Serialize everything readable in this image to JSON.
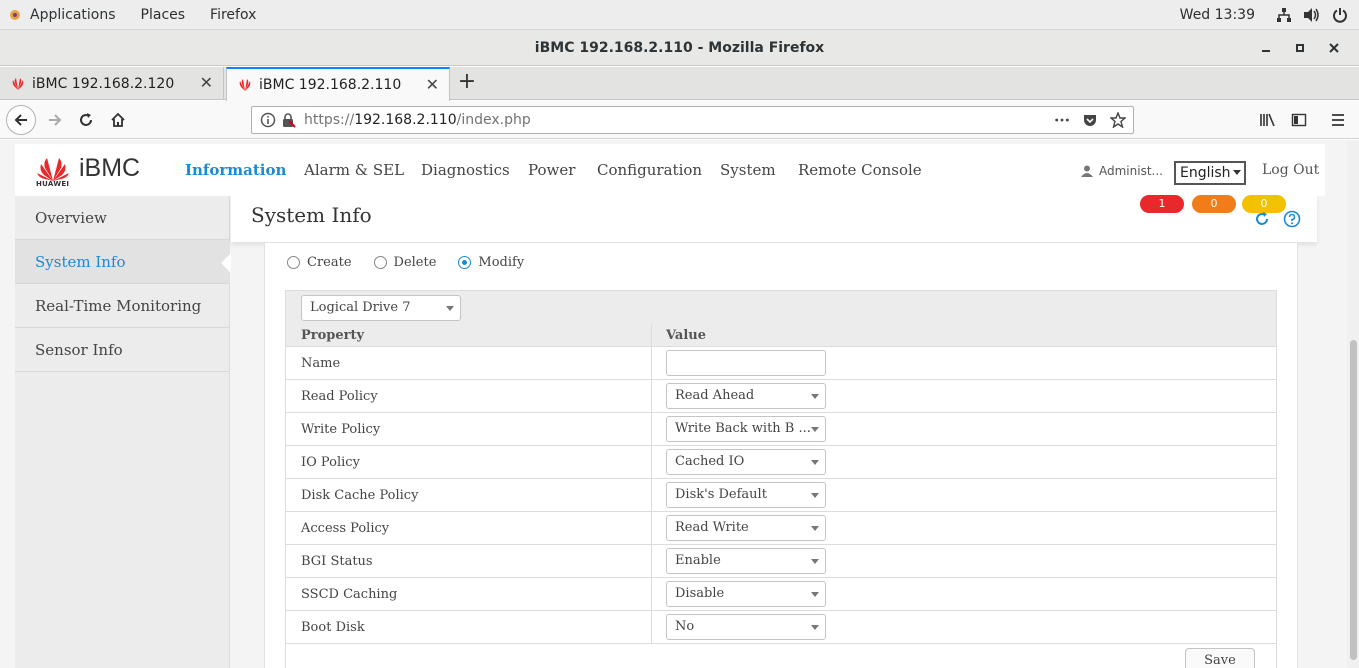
{
  "gnome": {
    "applications": "Applications",
    "places": "Places",
    "firefox": "Firefox",
    "clock": "Wed 13:39"
  },
  "window": {
    "title": "iBMC 192.168.2.110 - Mozilla Firefox"
  },
  "tabs": [
    {
      "label": "iBMC 192.168.2.120"
    },
    {
      "label": "iBMC 192.168.2.110"
    }
  ],
  "url": {
    "prefix": "https://",
    "host": "192.168.2.110",
    "path": "/index.php"
  },
  "ibmc": {
    "logo": "iBMC",
    "brand": "HUAWEI",
    "menu": [
      "Information",
      "Alarm & SEL",
      "Diagnostics",
      "Power",
      "Configuration",
      "System",
      "Remote Console"
    ],
    "user": "Administ...",
    "language": "English",
    "logout": "Log Out",
    "alarms": {
      "critical": "1",
      "major": "0",
      "minor": "0"
    },
    "colors": {
      "accent": "#1a8bd4",
      "critical": "#e8282b",
      "major": "#f07d1a",
      "minor": "#f2c200"
    }
  },
  "sidebar": {
    "items": [
      {
        "label": "Overview"
      },
      {
        "label": "System Info"
      },
      {
        "label": "Real-Time Monitoring"
      },
      {
        "label": "Sensor Info"
      }
    ]
  },
  "content": {
    "title": "System Info",
    "radios": [
      "Create",
      "Delete",
      "Modify"
    ],
    "selected_radio": "Modify",
    "logical_drive": "Logical Drive 7",
    "table": {
      "headers": [
        "Property",
        "Value"
      ],
      "rows": [
        {
          "property": "Name",
          "value": ""
        },
        {
          "property": "Read Policy",
          "value": "Read Ahead"
        },
        {
          "property": "Write Policy",
          "value": "Write Back with B ..."
        },
        {
          "property": "IO Policy",
          "value": "Cached IO"
        },
        {
          "property": "Disk Cache Policy",
          "value": "Disk's Default"
        },
        {
          "property": "Access Policy",
          "value": "Read Write"
        },
        {
          "property": "BGI Status",
          "value": "Enable"
        },
        {
          "property": "SSCD Caching",
          "value": "Disable"
        },
        {
          "property": "Boot Disk",
          "value": "No"
        }
      ]
    },
    "save": "Save"
  }
}
